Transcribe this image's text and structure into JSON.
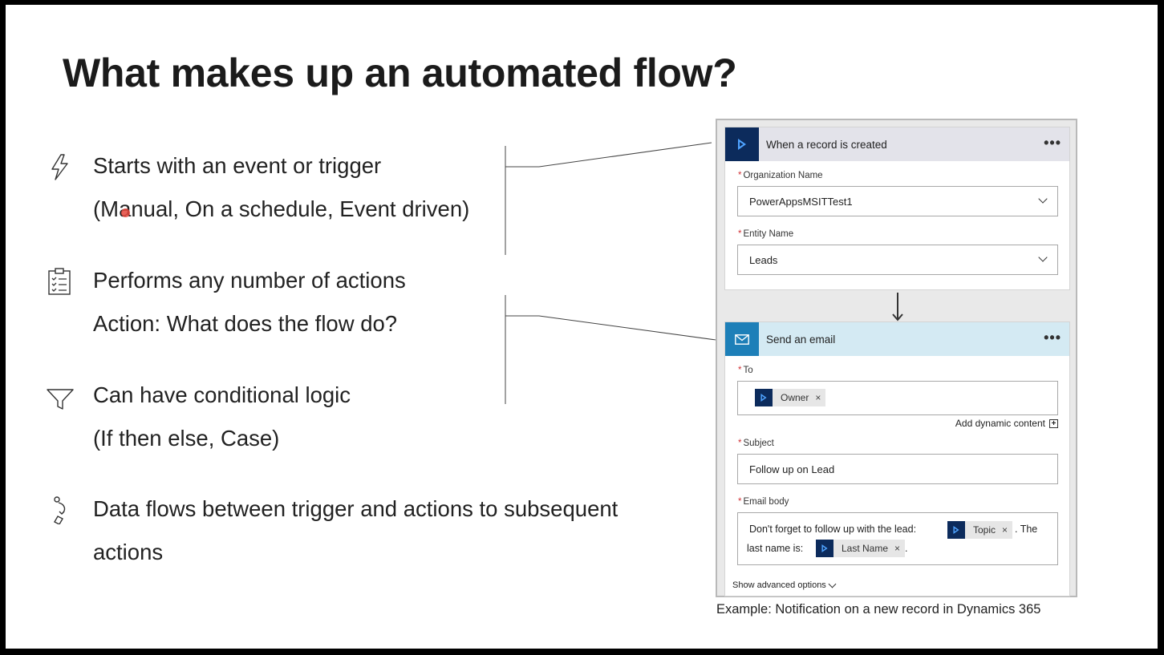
{
  "slide": {
    "title": "What makes up an automated flow?",
    "bullets": [
      {
        "icon": "lightning-icon",
        "lines": [
          "Starts with an event or trigger",
          "(Manual, On a schedule, Event driven)"
        ]
      },
      {
        "icon": "clipboard-checklist-icon",
        "lines": [
          "Performs any number of actions",
          "Action: What does the flow do?"
        ]
      },
      {
        "icon": "funnel-icon",
        "lines": [
          "Can have conditional logic",
          "(If then else, Case)"
        ]
      },
      {
        "icon": "data-flow-icon",
        "lines": [
          "Data flows between trigger and actions to subsequent",
          "actions"
        ]
      }
    ],
    "caption": "Example: Notification on a new record in Dynamics 365"
  },
  "flow": {
    "trigger": {
      "title": "When a record is created",
      "more": "•••",
      "org_label": "Organization Name",
      "org_value": "PowerAppsMSITTest1",
      "entity_label": "Entity Name",
      "entity_value": "Leads"
    },
    "action": {
      "title": "Send an email",
      "more": "•••",
      "to_label": "To",
      "to_token": "Owner",
      "add_dynamic": "Add dynamic content",
      "subject_label": "Subject",
      "subject_value": "Follow up on Lead",
      "body_label": "Email body",
      "body_text_1": "Don't forget to follow up with the lead:",
      "body_token_1": "Topic",
      "body_text_2": ". The",
      "body_text_3": "last name is:",
      "body_token_2": "Last Name",
      "body_text_4": "."
    },
    "show_advanced": "Show advanced options",
    "token_close": "×",
    "required_mark": "*"
  },
  "colors": {
    "dynamics_icon_bg": "#0c2b5c",
    "mail_icon_bg": "#1d7fb8",
    "trigger_header_bg": "#e3e3ea",
    "email_header_bg": "#d4eaf3",
    "required_star": "#d13438"
  }
}
